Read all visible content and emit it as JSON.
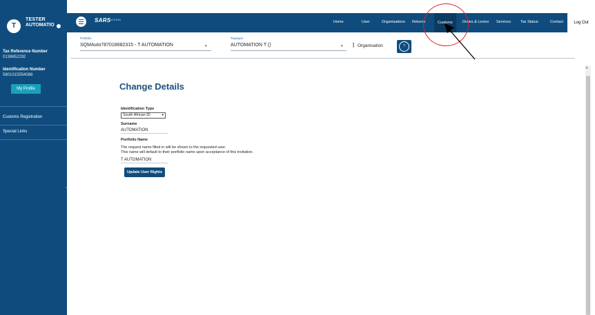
{
  "sidebar": {
    "avatar_letter": "T",
    "user_first": "TESTER",
    "user_last": "AUTOMATIO",
    "tax_ref_label": "Tax Reference Number",
    "tax_ref_value": "0138652292",
    "id_label": "Identification Number",
    "id_value": "5801015554088",
    "profile_button": "My Profile",
    "links": [
      "Customs Registration",
      "Special Links"
    ]
  },
  "header": {
    "logo_text": "SARS",
    "logo_sub": "eFILING",
    "nav": [
      "Home",
      "User",
      "Organisations",
      "Returns",
      "Customs",
      "Duties & Levies",
      "Services",
      "Tax Status",
      "Contact"
    ],
    "logout": "Log Out",
    "active_nav": "Customs"
  },
  "selectors": {
    "portfolio_label": "Portfolio",
    "portfolio_value": "SQMAuto787018682315 - T AUTOMATION",
    "taxpayer_label": "Taxpayer",
    "taxpayer_value": "AUTOMATION T ()",
    "organisation_label": "Organisation"
  },
  "form": {
    "title": "Change Details",
    "id_type_label": "Identification Type",
    "id_type_value": "South African ID",
    "surname_label": "Surname",
    "surname_value": "AUTOMATION",
    "portfolio_name_label": "Portfolio Name",
    "note_line1": "The request name filled in will be shown to the requested user.",
    "note_line2": "This name will default to their portfolio name upon acceptance of this invitation.",
    "portfolio_name_value": "T AUTOMATION",
    "submit_button": "Update User Rights"
  },
  "colors": {
    "brand": "#0f4c7d",
    "accent": "#1aa0b8",
    "annotation": "#e02020"
  },
  "icons": {
    "menu": "hamburger-icon",
    "help": "help-desk-icon",
    "dropdown": "chevron-down-icon",
    "more": "kebab-icon"
  }
}
